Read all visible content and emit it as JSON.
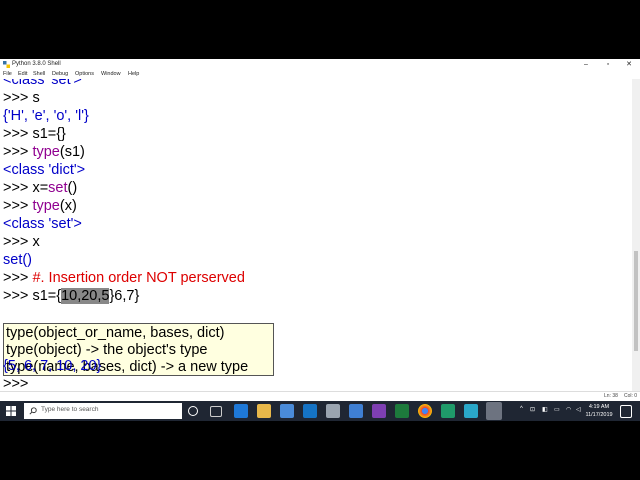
{
  "window": {
    "title": "Python 3.8.0 Shell"
  },
  "menu": [
    "File",
    "Edit",
    "Shell",
    "Debug",
    "Options",
    "Window",
    "Help"
  ],
  "shell": {
    "cutoff_line": "<class 'set'>",
    "lines": [
      {
        "prompt": ">>> ",
        "code": "s"
      },
      {
        "output": "{'H', 'e', 'o', 'l'}"
      },
      {
        "prompt": ">>> ",
        "code": "s1={}"
      },
      {
        "prompt": ">>> ",
        "kw": "type",
        "rest": "(s1)"
      },
      {
        "output": "<class 'dict'>"
      },
      {
        "prompt": ">>> ",
        "pre": "x=",
        "kw": "set",
        "rest": "()"
      },
      {
        "prompt": ">>> ",
        "kw": "type",
        "rest": "(x)"
      },
      {
        "output": "<class 'set'>"
      },
      {
        "prompt": ">>> ",
        "code": "x"
      },
      {
        "output": "set()"
      },
      {
        "prompt": ">>> ",
        "comment": "#. Insertion order NOT perserved"
      }
    ],
    "current_prefix": "s1={",
    "current_selected": "10,20,5",
    "current_suffix": "}6,7}",
    "result": "{5, 6, 7, 10, 20}",
    "last_prompt": ">>> "
  },
  "calltip": [
    "type(object_or_name, bases, dict)",
    "type(object) -> the object's type",
    "type(name, bases, dict) -> a new type"
  ],
  "status": {
    "line": "Ln: 38",
    "col": "Col: 0"
  },
  "taskbar": {
    "search_placeholder": "Type here to search",
    "time": "4:19 AM",
    "date": "11/17/2019"
  }
}
